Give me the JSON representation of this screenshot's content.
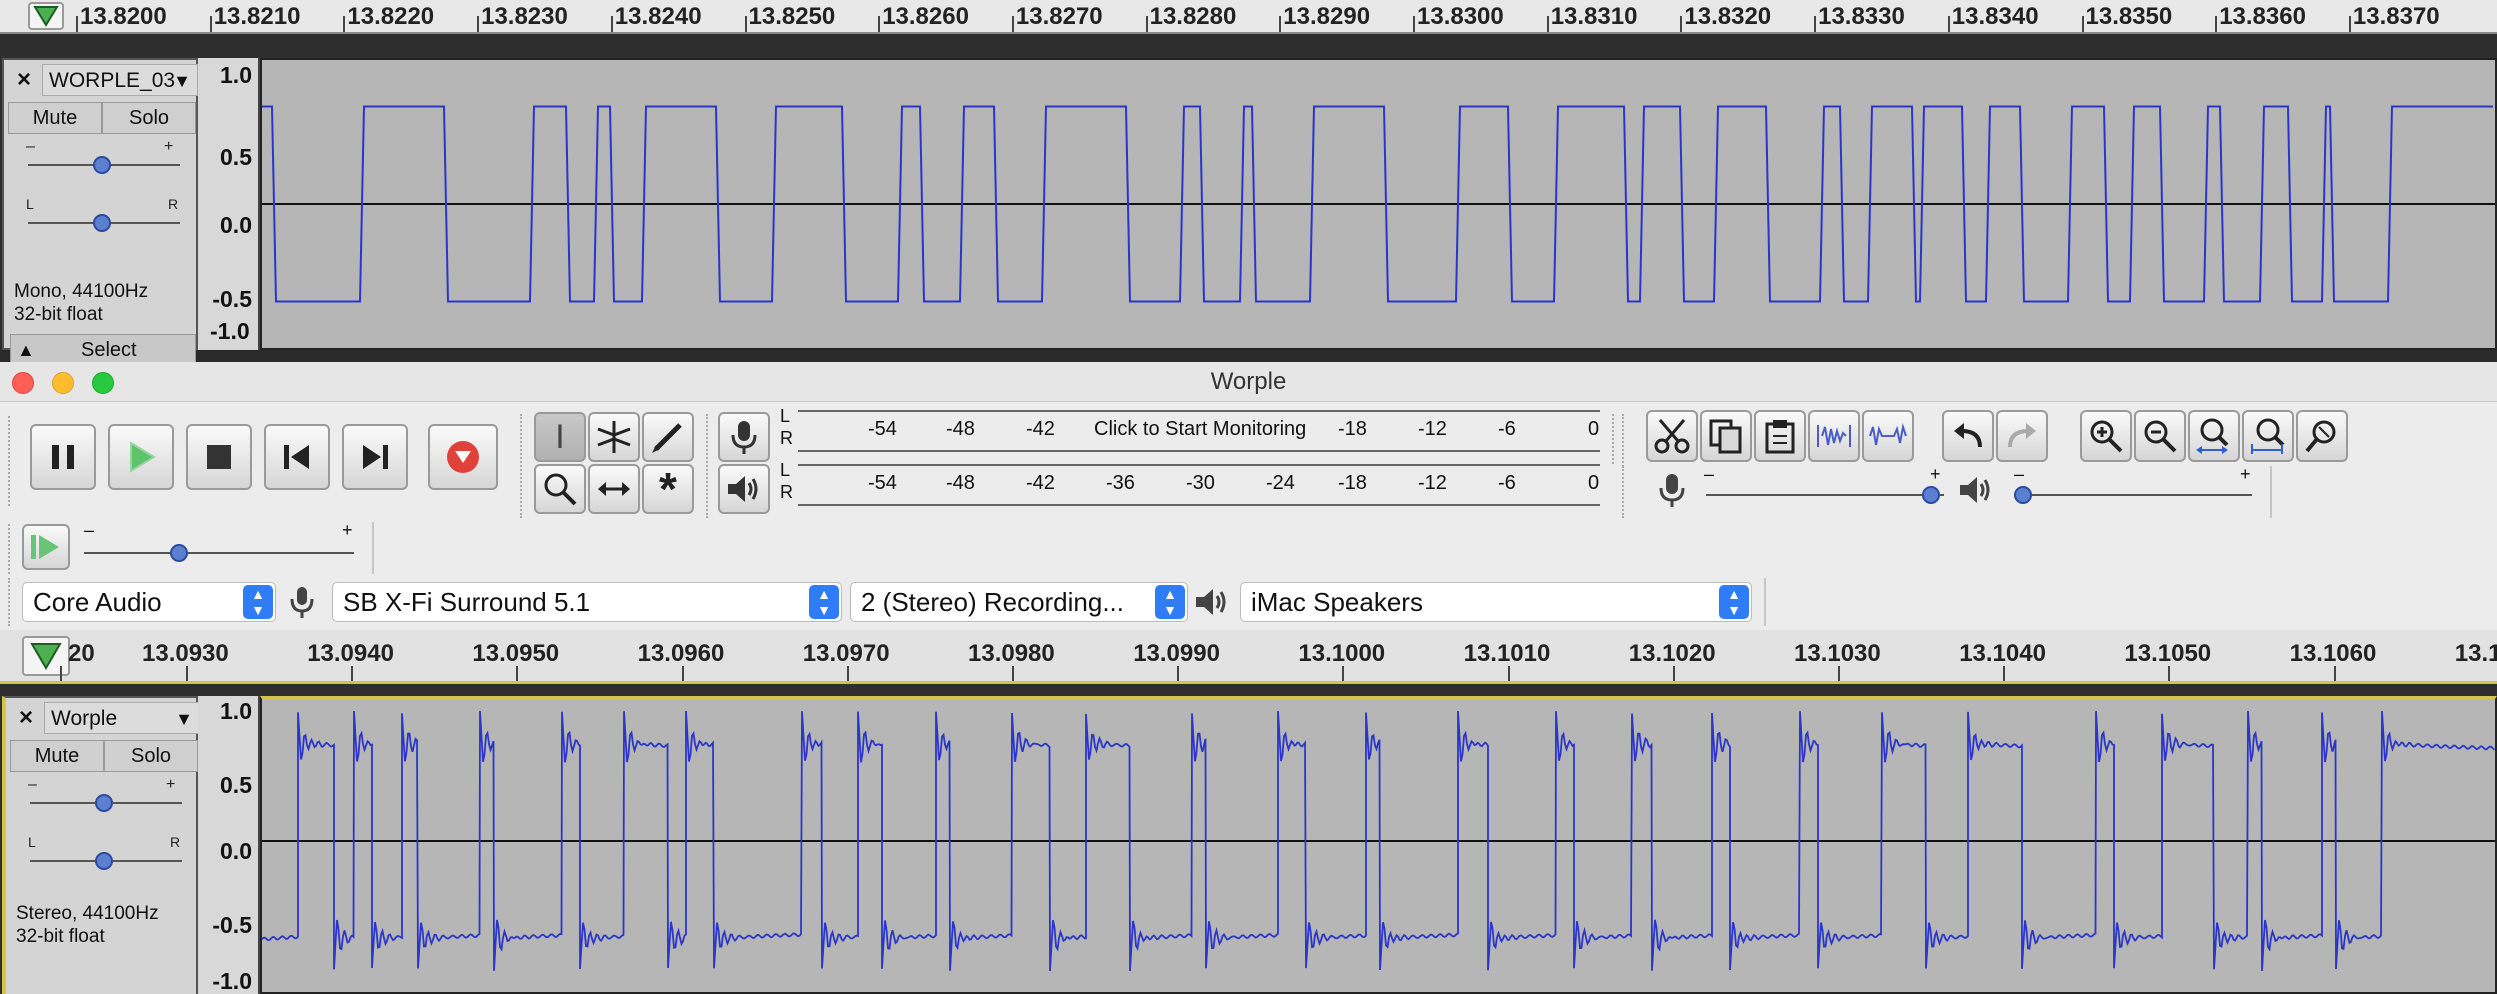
{
  "top_ruler": {
    "labels": [
      "13.8200",
      "13.8210",
      "13.8220",
      "13.8230",
      "13.8240",
      "13.8250",
      "13.8260",
      "13.8270",
      "13.8280",
      "13.8290",
      "13.8300",
      "13.8310",
      "13.8320",
      "13.8330",
      "13.8340",
      "13.8350",
      "13.8360",
      "13.8370"
    ]
  },
  "track1": {
    "name": "WORPLE_03",
    "mute": "Mute",
    "solo": "Solo",
    "gain_minus": "–",
    "gain_plus": "+",
    "pan_left": "L",
    "pan_right": "R",
    "format_line1": "Mono, 44100Hz",
    "format_line2": "32-bit float",
    "select": "Select",
    "scale": [
      "1.0",
      "0.5",
      "0.0",
      "-0.5",
      "-1.0"
    ],
    "gain_level": 0.5,
    "pan_level": 0.5
  },
  "window": {
    "title": "Worple"
  },
  "meters": {
    "rec_L": "L",
    "rec_R": "R",
    "rec_ticks": [
      "-54",
      "-48",
      "-42",
      "-18",
      "-12",
      "-6",
      "0"
    ],
    "rec_prompt": "Click to Start Monitoring",
    "play_L": "L",
    "play_R": "R",
    "play_ticks": [
      "-54",
      "-48",
      "-42",
      "-36",
      "-30",
      "-24",
      "-18",
      "-12",
      "-6",
      "0"
    ]
  },
  "mixer": {
    "rec_minus": "–",
    "rec_plus": "+",
    "play_minus": "–",
    "play_plus": "+",
    "rec_level": 0.98,
    "play_level": 0.02
  },
  "playspeed": {
    "minus": "–",
    "plus": "+",
    "level": 0.35
  },
  "devices": {
    "host": "Core Audio",
    "input_device": "SB X-Fi Surround 5.1",
    "channels": "2 (Stereo) Recording...",
    "output_device": "iMac Speakers"
  },
  "bottom_ruler": {
    "labels": [
      "20",
      "13.0930",
      "13.0940",
      "13.0950",
      "13.0960",
      "13.0970",
      "13.0980",
      "13.0990",
      "13.1000",
      "13.1010",
      "13.1020",
      "13.1030",
      "13.1040",
      "13.1050",
      "13.1060",
      "13.10"
    ]
  },
  "track2": {
    "name": "Worple",
    "mute": "Mute",
    "solo": "Solo",
    "gain_minus": "–",
    "gain_plus": "+",
    "pan_left": "L",
    "pan_right": "R",
    "format_line1": "Stereo, 44100Hz",
    "format_line2": "32-bit float",
    "scale": [
      "1.0",
      "0.5",
      "0.0",
      "-0.5",
      "-1.0"
    ],
    "gain_level": 0.5,
    "pan_level": 0.5
  },
  "icons": {
    "pause": "pause-icon",
    "play": "play-icon",
    "stop": "stop-icon",
    "skip_start": "skip-to-start-icon",
    "skip_end": "skip-to-end-icon",
    "record": "record-icon",
    "select_tool": "selection-tool-icon",
    "envelope_tool": "envelope-tool-icon",
    "draw_tool": "draw-tool-icon",
    "zoom_tool": "zoom-tool-icon",
    "timeshift_tool": "time-shift-tool-icon",
    "multi_tool": "multi-tool-icon",
    "cut": "scissors-icon",
    "copy": "copy-icon",
    "paste": "paste-icon",
    "trim": "trim-icon",
    "silence": "silence-icon",
    "undo": "undo-icon",
    "redo": "redo-icon",
    "zoom_in": "zoom-in-icon",
    "zoom_out": "zoom-out-icon",
    "fit_selection": "fit-selection-icon",
    "fit_project": "fit-project-icon",
    "zoom_toggle": "zoom-toggle-icon"
  },
  "colors": {
    "waveform": "#2b36c8",
    "track_bg": "#b6b6b6",
    "record_red": "#e0413a",
    "accent_blue": "#2f7cf6"
  }
}
